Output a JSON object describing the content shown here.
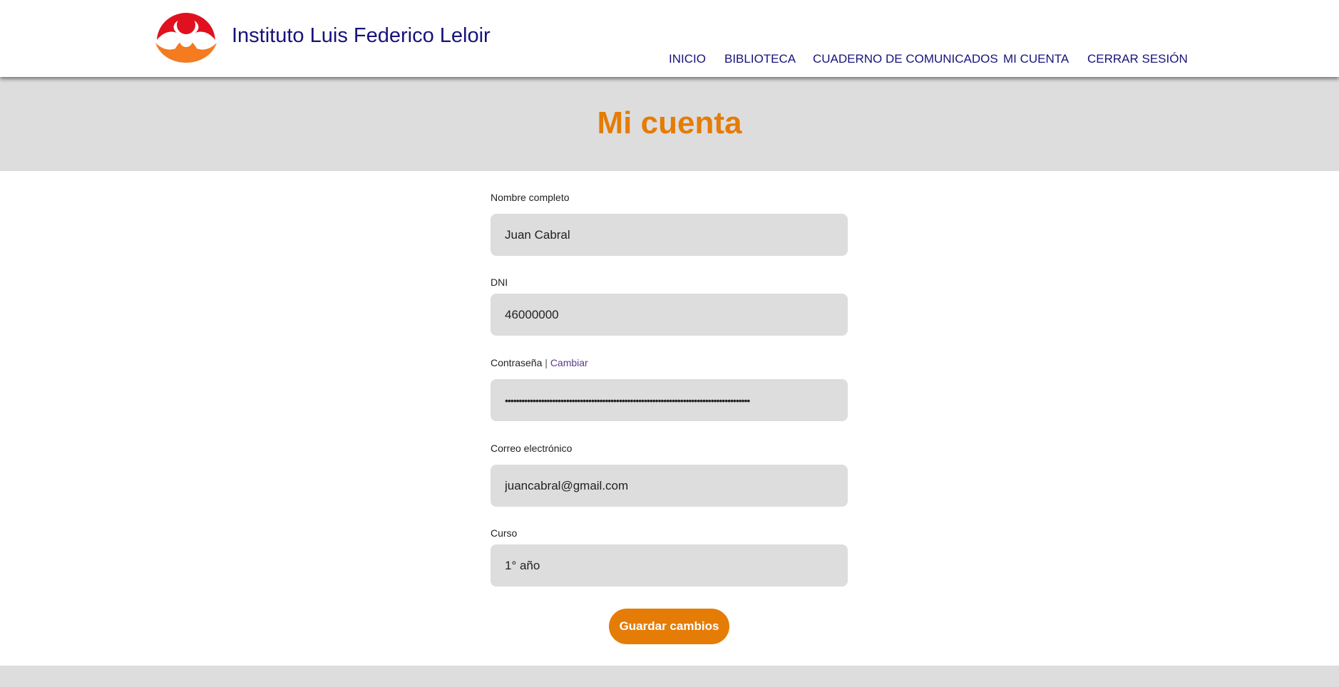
{
  "header": {
    "site_title": "Instituto Luis Federico Leloir",
    "logo_icon": "institute-logo-icon",
    "nav": [
      {
        "label": "INICIO"
      },
      {
        "label": "BIBLIOTECA"
      },
      {
        "label": "CUADERNO DE COMUNICADOS"
      },
      {
        "label": "MI CUENTA"
      },
      {
        "label": "CERRAR SESIÓN"
      }
    ]
  },
  "banner": {
    "title": "Mi cuenta"
  },
  "form": {
    "name_label": "Nombre completo",
    "name_value": "Juan Cabral",
    "dni_label": "DNI",
    "dni_value": "46000000",
    "password_label": "Contraseña",
    "password_separator": "|",
    "password_change_link": "Cambiar",
    "password_value": "••••••••••••••••••••••••••••••••••••••••••••••••••••••••••••••••••••••••••••••••••••••••",
    "email_label": "Correo electrónico",
    "email_value": "juancabral@gmail.com",
    "course_label": "Curso",
    "course_value": "1° año",
    "save_button": "Guardar cambios"
  },
  "colors": {
    "brand_navy": "#17137a",
    "accent_orange": "#e57c06",
    "banner_gray": "#dddddd",
    "logo_red": "#e0101f",
    "logo_orange": "#f47b20"
  }
}
